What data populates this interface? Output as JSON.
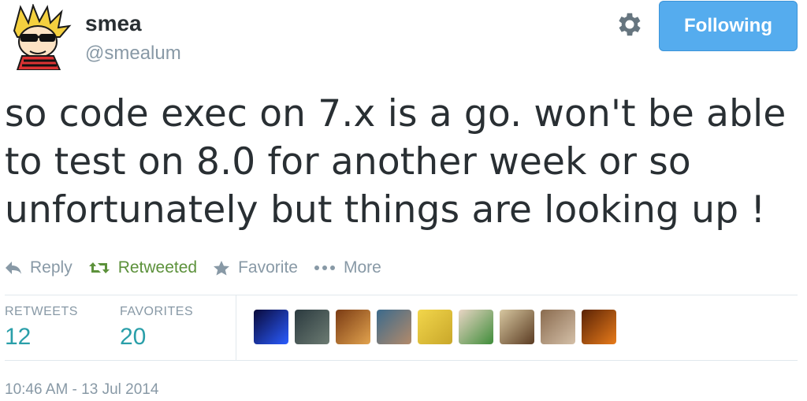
{
  "user": {
    "name": "smea",
    "handle": "@smealum",
    "avatar_icon": "calvin-avatar-icon"
  },
  "header": {
    "settings_icon": "gear-icon",
    "follow_label": "Following",
    "follow_color": "#55acee"
  },
  "tweet": {
    "lines": [
      "so code exec on 7.x is a go. won't be able",
      "to test on 8.0 for another week or so",
      "unfortunately but things are looking up !"
    ]
  },
  "actions": {
    "reply": "Reply",
    "retweet": "Retweeted",
    "favorite": "Favorite",
    "more": "More",
    "retweet_color": "#5c913b"
  },
  "stats": {
    "retweets_label": "RETWEETS",
    "retweets_value": "12",
    "favorites_label": "FAVORITES",
    "favorites_value": "20",
    "value_color": "#2a9fa9"
  },
  "favoriters": [
    {
      "icon": "night-lights-avatar",
      "colors": [
        "#0a0a3a",
        "#2a5cff"
      ]
    },
    {
      "icon": "dark-portrait-avatar",
      "colors": [
        "#2b3a3f",
        "#6c7b72"
      ]
    },
    {
      "icon": "dog-avatar",
      "colors": [
        "#7a3b14",
        "#e2a34e"
      ]
    },
    {
      "icon": "group-photo-avatar",
      "colors": [
        "#3b6a8c",
        "#b38a6a"
      ]
    },
    {
      "icon": "meme-face-avatar",
      "colors": [
        "#f2d64b",
        "#c9a72a"
      ]
    },
    {
      "icon": "green-shirt-avatar",
      "colors": [
        "#e9d5c4",
        "#3f8d3a"
      ]
    },
    {
      "icon": "anime-girl-avatar",
      "colors": [
        "#d7c7a0",
        "#5a3b22"
      ]
    },
    {
      "icon": "sepia-portrait-avatar",
      "colors": [
        "#8a6b4f",
        "#d4c0a8"
      ]
    },
    {
      "icon": "orange-avatar",
      "colors": [
        "#5a2306",
        "#e87b1a"
      ]
    }
  ],
  "timestamp": "10:46 AM - 13 Jul 2014"
}
